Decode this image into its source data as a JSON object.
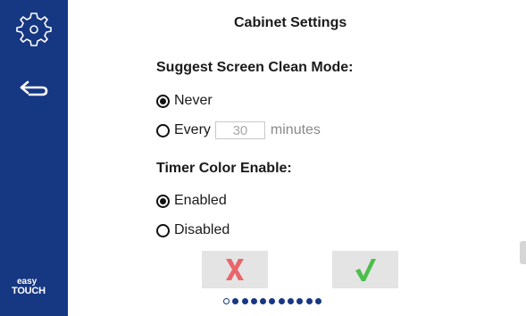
{
  "app": {
    "brand_line1": "easy",
    "brand_line2": "TOUCH",
    "accent_color": "#163782"
  },
  "sidebar": {
    "settings_icon": "gear-icon",
    "back_icon": "back-arrow-icon"
  },
  "page": {
    "title": "Cabinet Settings"
  },
  "screen_clean": {
    "heading": "Suggest Screen Clean Mode:",
    "option_never": "Never",
    "option_every": "Every",
    "minutes_value": "30",
    "minutes_unit": "minutes",
    "selected": "Never"
  },
  "timer_color": {
    "heading": "Timer Color Enable:",
    "option_enabled": "Enabled",
    "option_disabled": "Disabled",
    "selected": "Enabled"
  },
  "actions": {
    "cancel_icon": "x-icon",
    "cancel_color": "#e8666b",
    "confirm_icon": "checkmark-icon",
    "confirm_color": "#4cbe4c"
  },
  "pagination": {
    "total_pages": 11,
    "current_page": 1
  }
}
